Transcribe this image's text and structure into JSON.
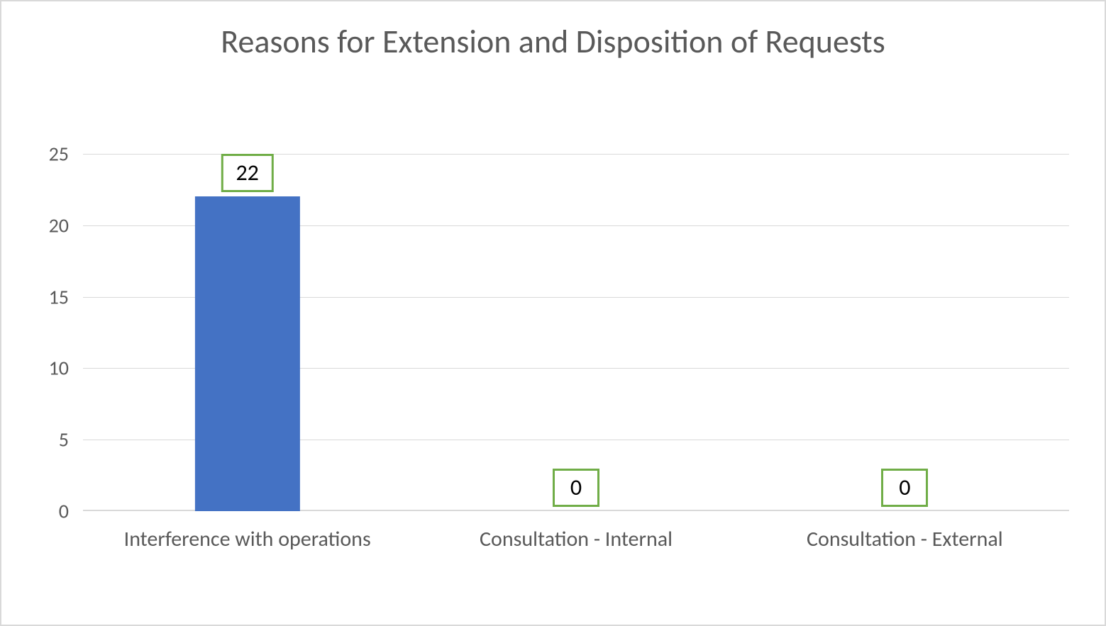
{
  "chart_data": {
    "type": "bar",
    "title": "Reasons for Extension and Disposition of Requests",
    "categories": [
      "Interference with operations",
      "Consultation - Internal",
      "Consultation - External"
    ],
    "values": [
      22,
      0,
      0
    ],
    "ylim": [
      0,
      25
    ],
    "ytick_step": 5,
    "yticks": [
      0,
      5,
      10,
      15,
      20,
      25
    ],
    "xlabel": "",
    "ylabel": "",
    "bar_color": "#4472c4",
    "label_border_color": "#70ad47"
  }
}
